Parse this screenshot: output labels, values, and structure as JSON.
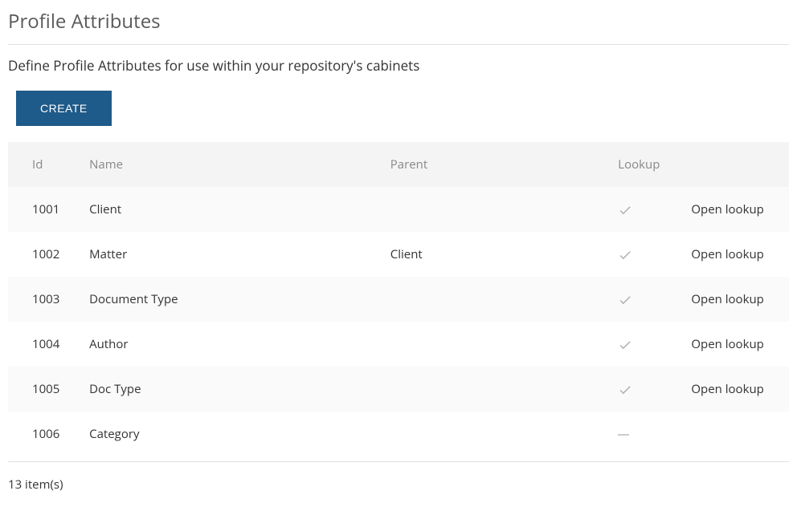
{
  "page": {
    "title": "Profile Attributes",
    "subtitle": "Define Profile Attributes for use within your repository's cabinets"
  },
  "buttons": {
    "create": "CREATE"
  },
  "table": {
    "headers": {
      "id": "Id",
      "name": "Name",
      "parent": "Parent",
      "lookup": "Lookup"
    },
    "rows": [
      {
        "id": "1001",
        "name": "Client",
        "parent": "",
        "lookup": true,
        "action": "Open lookup"
      },
      {
        "id": "1002",
        "name": "Matter",
        "parent": "Client",
        "lookup": true,
        "action": "Open lookup"
      },
      {
        "id": "1003",
        "name": "Document Type",
        "parent": "",
        "lookup": true,
        "action": "Open lookup"
      },
      {
        "id": "1004",
        "name": "Author",
        "parent": "",
        "lookup": true,
        "action": "Open lookup"
      },
      {
        "id": "1005",
        "name": "Doc Type",
        "parent": "",
        "lookup": true,
        "action": "Open lookup"
      },
      {
        "id": "1006",
        "name": "Category",
        "parent": "",
        "lookup": false,
        "action": ""
      }
    ]
  },
  "footer": {
    "count_text": "13 item(s)"
  }
}
